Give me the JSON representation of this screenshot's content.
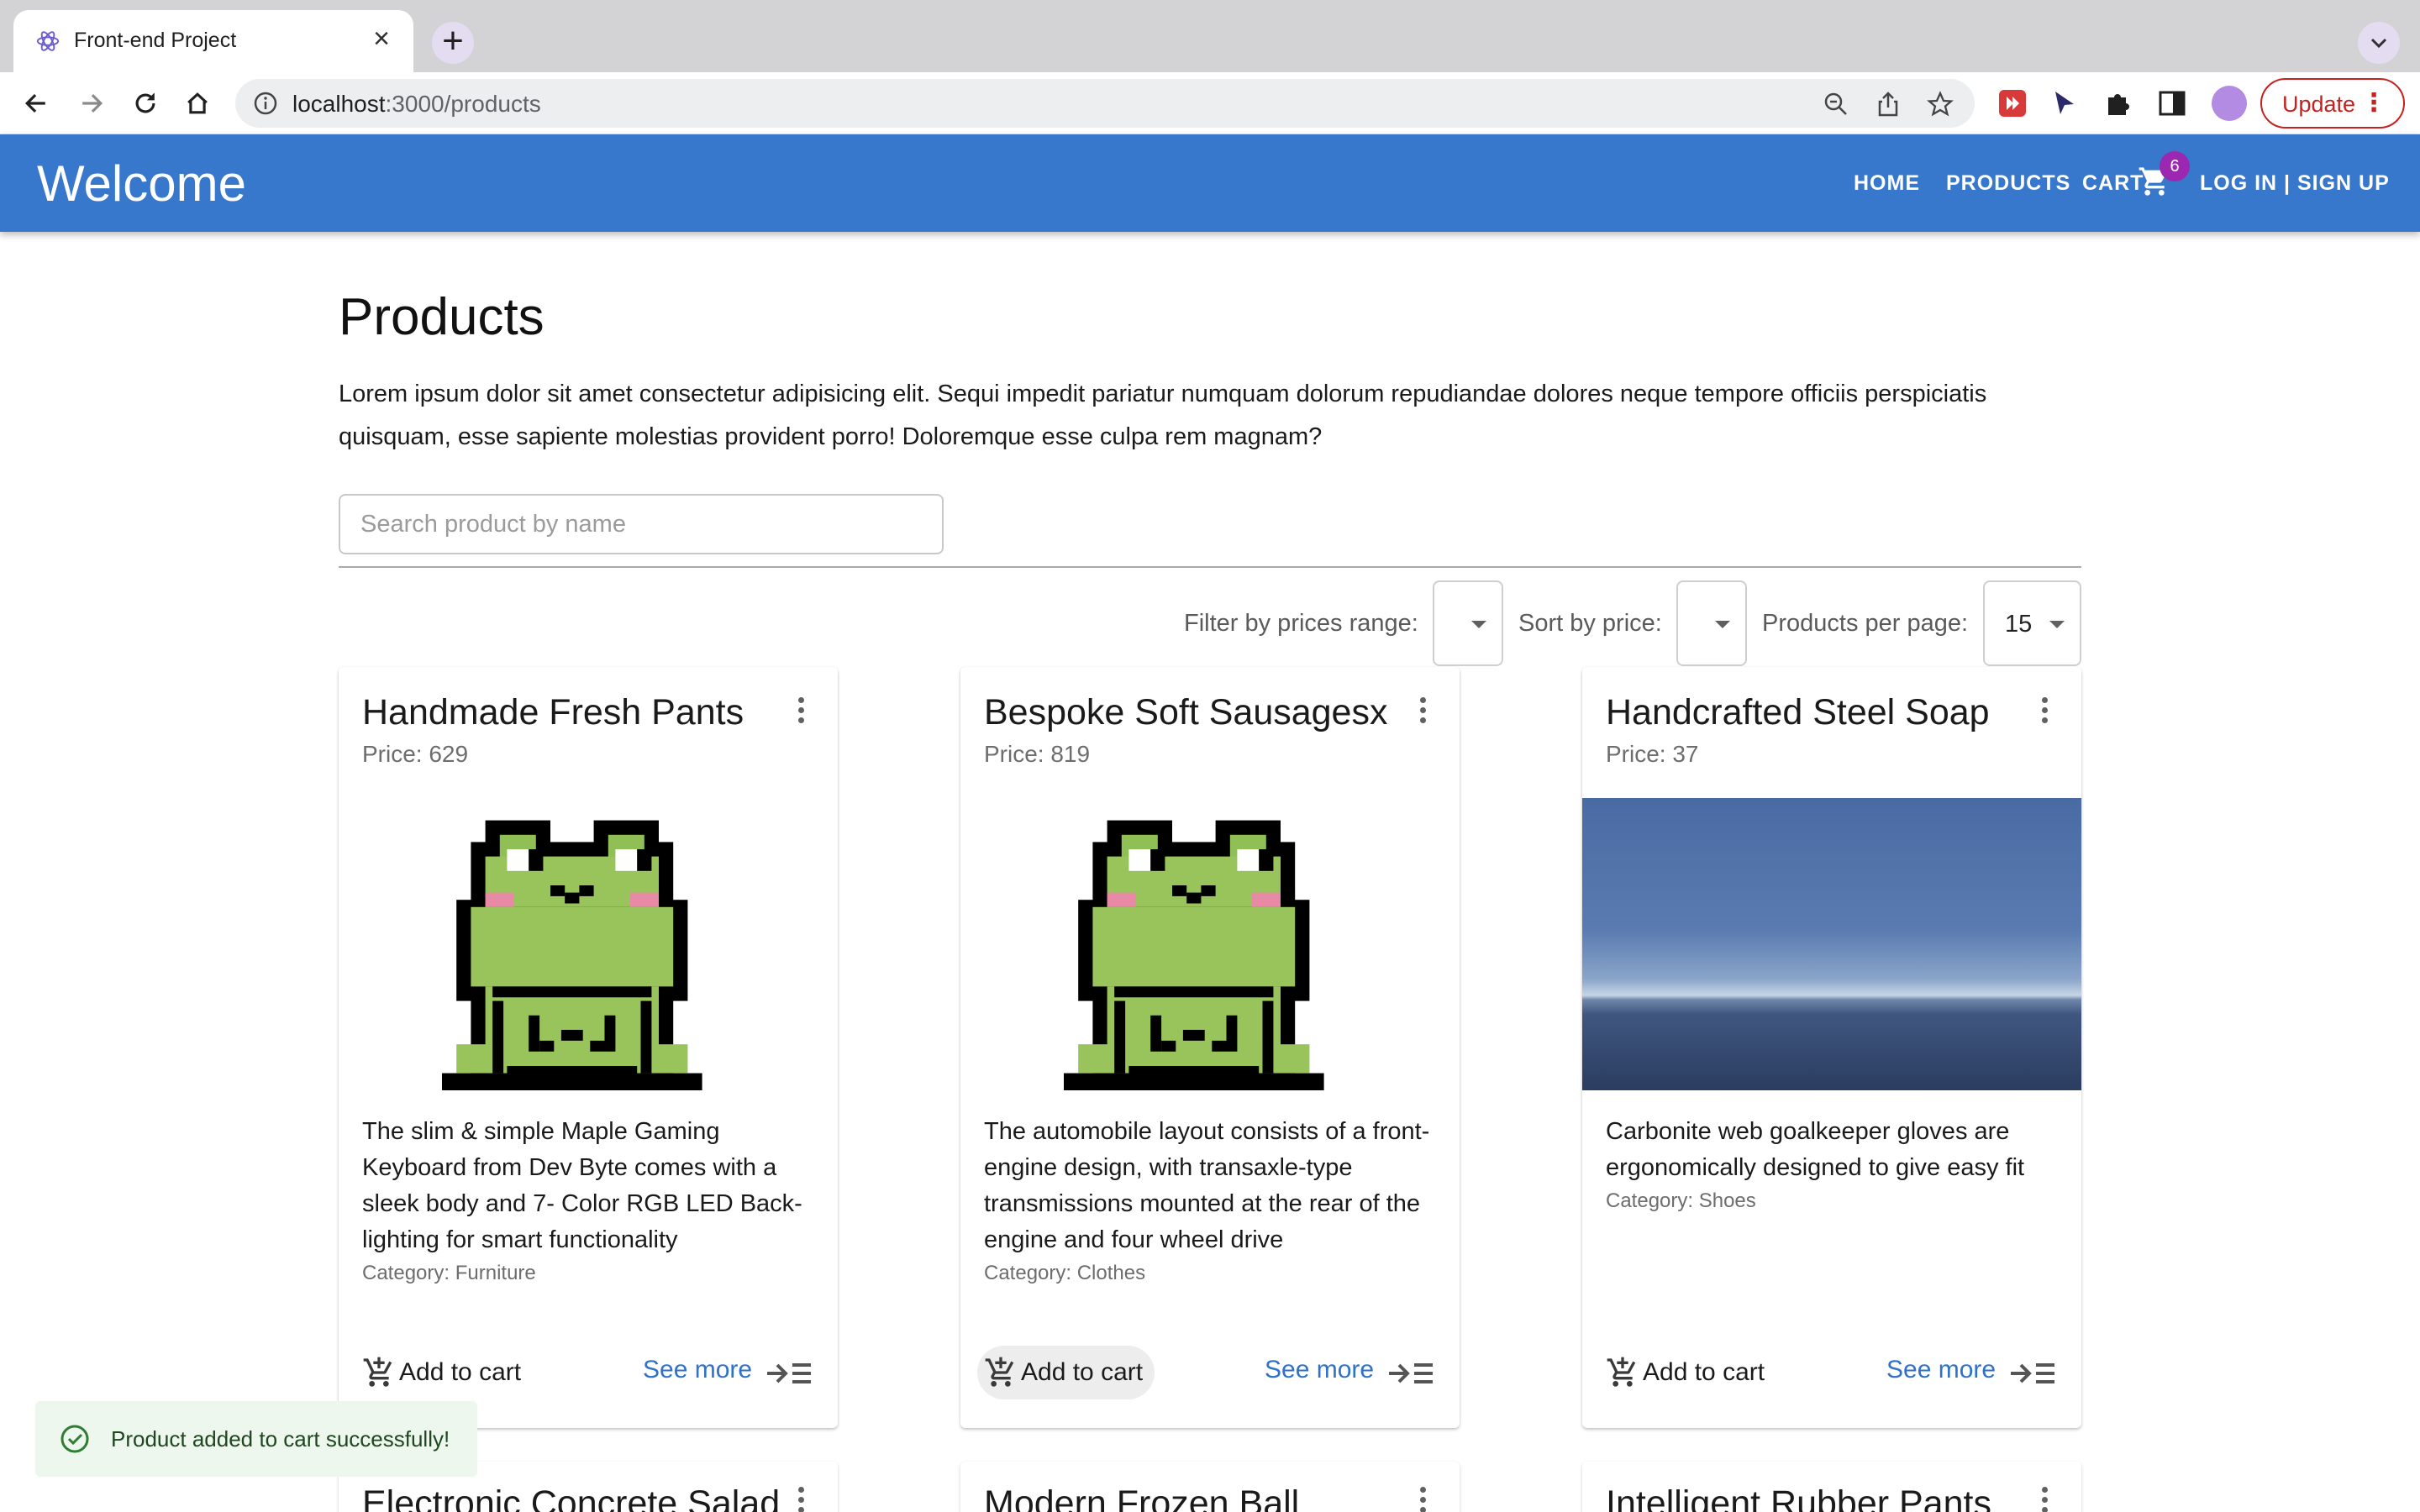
{
  "browser": {
    "tab_title": "Front-end Project",
    "url_host": "localhost",
    "url_rest": ":3000/products",
    "update_label": "Update"
  },
  "appbar": {
    "title": "Welcome",
    "nav": {
      "home": "HOME",
      "products": "PRODUCTS",
      "cart": "CART",
      "login": "LOG IN | SIGN UP"
    },
    "cart_count": "6",
    "color": "#3777cc"
  },
  "page": {
    "title": "Products",
    "intro": "Lorem ipsum dolor sit amet consectetur adipisicing elit. Sequi impedit pariatur numquam dolorum repudiandae dolores neque tempore officiis perspiciatis quisquam, esse sapiente molestias provident porro! Doloremque esse culpa rem magnam?",
    "search_placeholder": "Search product by name"
  },
  "controls": {
    "filter_label": "Filter by prices range:",
    "filter_value": "",
    "sort_label": "Sort by price:",
    "sort_value": "",
    "per_page_label": "Products per page:",
    "per_page_value": "15"
  },
  "cards": [
    {
      "title": "Handmade Fresh Pants",
      "price": "Price: 629",
      "image": "pixel-frog",
      "description": "The slim & simple Maple Gaming Keyboard from Dev Byte comes with a sleek body and 7- Color RGB LED Back-lighting for smart functionality",
      "category": "Category: Furniture",
      "add_label": "Add to cart",
      "see_more": "See more"
    },
    {
      "title": "Bespoke Soft Sausagesx",
      "price": "Price: 819",
      "image": "pixel-frog",
      "description": "The automobile layout consists of a front-engine design, with transaxle-type transmissions mounted at the rear of the engine and four wheel drive",
      "category": "Category: Clothes",
      "add_label": "Add to cart",
      "see_more": "See more"
    },
    {
      "title": "Handcrafted Steel Soap",
      "price": "Price: 37",
      "image": "sea-horizon",
      "description": "Carbonite web goalkeeper gloves are ergonomically designed to give easy fit",
      "category": "Category: Shoes",
      "add_label": "Add to cart",
      "see_more": "See more"
    }
  ],
  "next_row": [
    {
      "title": "Electronic Concrete Salad"
    },
    {
      "title": "Modern Frozen Ball"
    },
    {
      "title": "Intelligent Rubber Pants"
    }
  ],
  "snackbar": {
    "message": "Product added to cart successfully!",
    "status_color": "#2e7d32"
  }
}
